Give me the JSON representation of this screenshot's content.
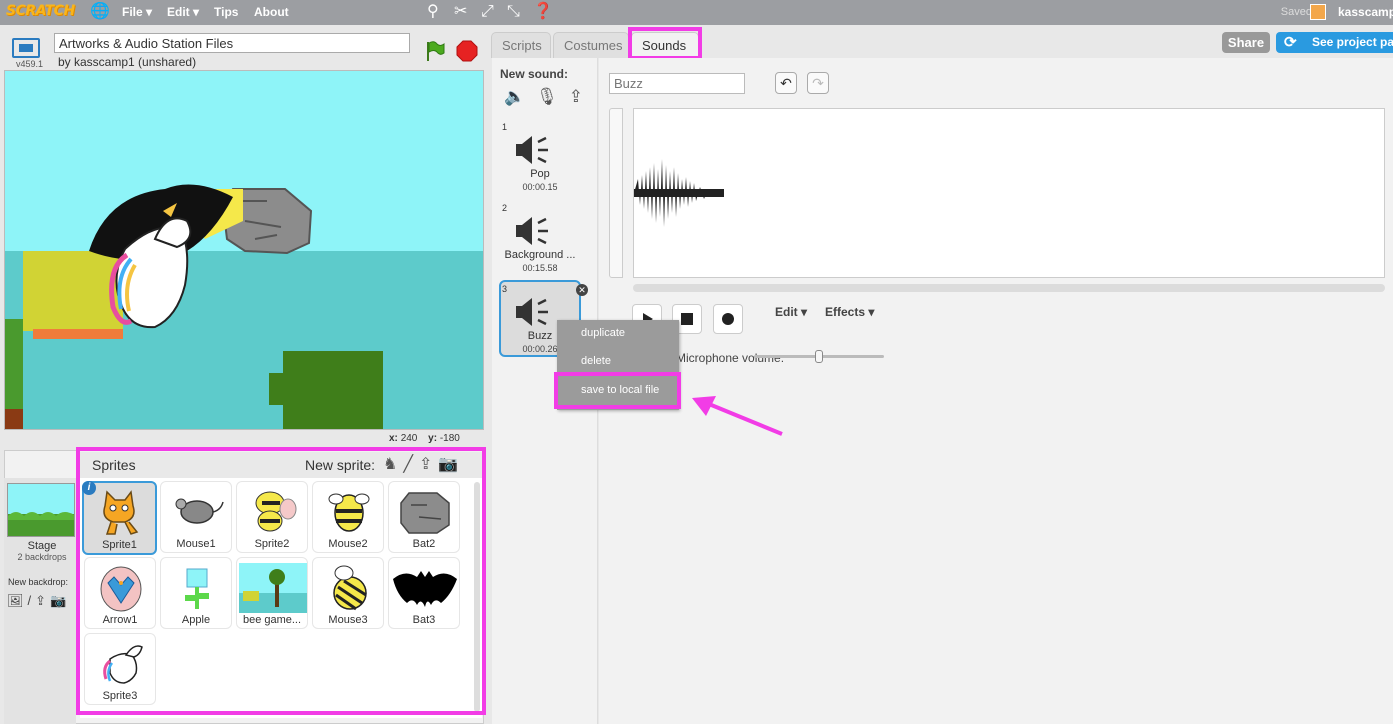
{
  "topbar": {
    "logo": "SCRATCH",
    "menu": [
      "File ▾",
      "Edit ▾",
      "Tips",
      "About"
    ],
    "saved": "Saved",
    "username": "kasscamp"
  },
  "stage_header": {
    "version": "v459.1",
    "project_title": "Artworks & Audio Station Files",
    "byline": "by kasscamp1 (unshared)"
  },
  "coords": {
    "x_label": "x:",
    "x_value": "240",
    "y_label": "y:",
    "y_value": "-180"
  },
  "sprites": {
    "title": "Sprites",
    "new_sprite_label": "New sprite:",
    "stage_label": "Stage",
    "stage_sub": "2 backdrops",
    "new_backdrop_label": "New backdrop:",
    "items": [
      {
        "label": "Sprite1"
      },
      {
        "label": "Mouse1"
      },
      {
        "label": "Sprite2"
      },
      {
        "label": "Mouse2"
      },
      {
        "label": "Bat2"
      },
      {
        "label": "Arrow1"
      },
      {
        "label": "Apple"
      },
      {
        "label": "bee game..."
      },
      {
        "label": "Mouse3"
      },
      {
        "label": "Bat3"
      },
      {
        "label": "Sprite3"
      }
    ]
  },
  "tabs": {
    "scripts": "Scripts",
    "costumes": "Costumes",
    "sounds": "Sounds"
  },
  "actions": {
    "share": "Share",
    "see_project": "See project page"
  },
  "sounds": {
    "new_sound_label": "New sound:",
    "items": [
      {
        "num": "1",
        "name": "Pop",
        "duration": "00:00.15"
      },
      {
        "num": "2",
        "name": "Background ...",
        "duration": "00:15.58"
      },
      {
        "num": "3",
        "name": "Buzz",
        "duration": "00:00.26"
      }
    ]
  },
  "editor": {
    "sound_name": "Buzz",
    "edit_menu": "Edit ▾",
    "effects_menu": "Effects ▾",
    "mic_volume": "Microphone volume:",
    "mic_volume_level": 0.5
  },
  "context_menu": {
    "duplicate": "duplicate",
    "delete": "delete",
    "save": "save to local file"
  },
  "colors": {
    "highlight": "#f23ce6",
    "accent": "#3a9ad9",
    "topbar": "#9c9ea2"
  }
}
